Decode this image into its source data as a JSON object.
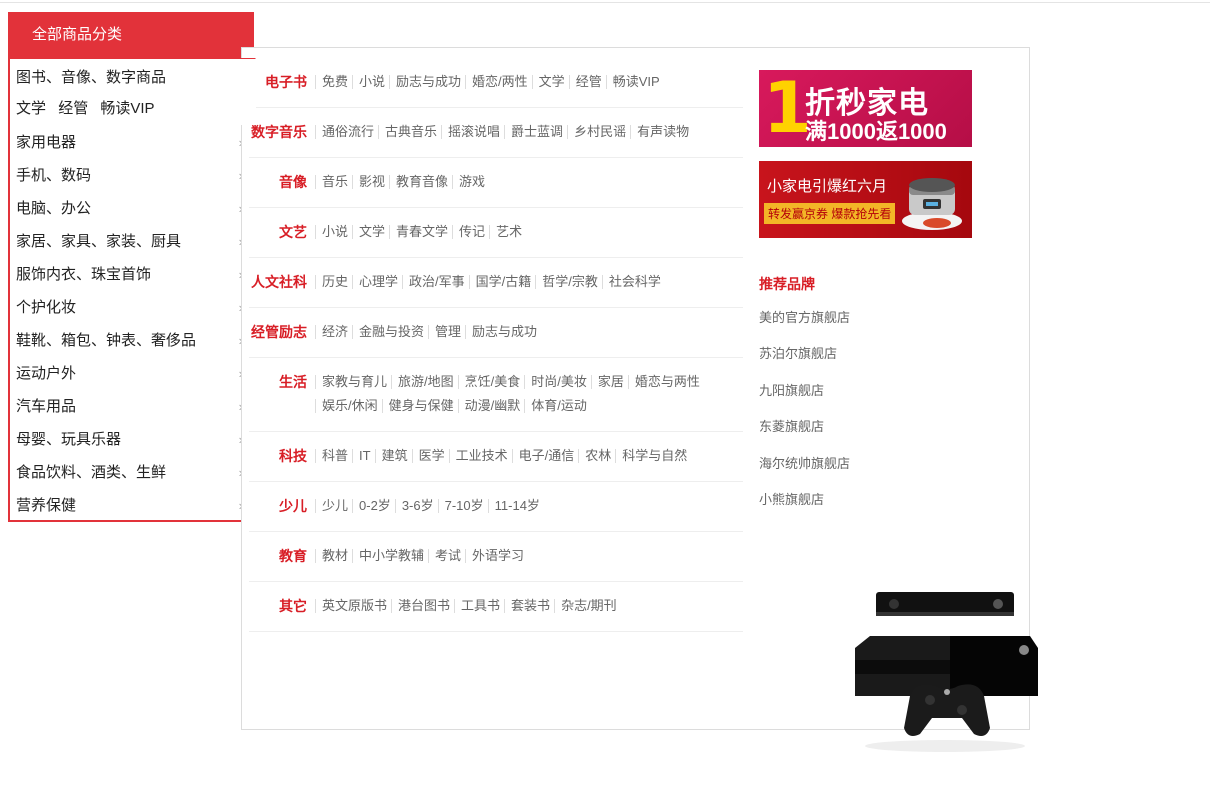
{
  "category_header": "全部商品分类",
  "active_category": {
    "line1": "图书、音像、数字商品",
    "line2": [
      "文学",
      "经管",
      "畅读VIP"
    ]
  },
  "categories": [
    {
      "label": "家用电器"
    },
    {
      "label": "手机、数码"
    },
    {
      "label": "电脑、办公"
    },
    {
      "label": "家居、家具、家装、厨具"
    },
    {
      "label": "服饰内衣、珠宝首饰"
    },
    {
      "label": "个护化妆"
    },
    {
      "label": "鞋靴、箱包、钟表、奢侈品"
    },
    {
      "label": "运动户外"
    },
    {
      "label": "汽车用品"
    },
    {
      "label": "母婴、玩具乐器"
    },
    {
      "label": "食品饮料、酒类、生鲜"
    },
    {
      "label": "营养保健"
    }
  ],
  "arrow_glyph": "›",
  "subcategories": [
    {
      "title": "电子书",
      "links": [
        "免费",
        "小说",
        "励志与成功",
        "婚恋/两性",
        "文学",
        "经管",
        "畅读VIP"
      ]
    },
    {
      "title": "数字音乐",
      "links": [
        "通俗流行",
        "古典音乐",
        "摇滚说唱",
        "爵士蓝调",
        "乡村民谣",
        "有声读物"
      ]
    },
    {
      "title": "音像",
      "links": [
        "音乐",
        "影视",
        "教育音像",
        "游戏"
      ]
    },
    {
      "title": "文艺",
      "links": [
        "小说",
        "文学",
        "青春文学",
        "传记",
        "艺术"
      ]
    },
    {
      "title": "人文社科",
      "links": [
        "历史",
        "心理学",
        "政治/军事",
        "国学/古籍",
        "哲学/宗教",
        "社会科学"
      ]
    },
    {
      "title": "经管励志",
      "links": [
        "经济",
        "金融与投资",
        "管理",
        "励志与成功"
      ]
    },
    {
      "title": "生活",
      "links": [
        "家教与育儿",
        "旅游/地图",
        "烹饪/美食",
        "时尚/美妆",
        "家居",
        "婚恋与两性",
        "娱乐/休闲",
        "健身与保健",
        "动漫/幽默",
        "体育/运动"
      ]
    },
    {
      "title": "科技",
      "links": [
        "科普",
        "IT",
        "建筑",
        "医学",
        "工业技术",
        "电子/通信",
        "农林",
        "科学与自然"
      ]
    },
    {
      "title": "少儿",
      "links": [
        "少儿",
        "0-2岁",
        "3-6岁",
        "7-10岁",
        "11-14岁"
      ]
    },
    {
      "title": "教育",
      "links": [
        "教材",
        "中小学教辅",
        "考试",
        "外语学习"
      ]
    },
    {
      "title": "其它",
      "links": [
        "英文原版书",
        "港台图书",
        "工具书",
        "套装书",
        "杂志/期刊"
      ]
    }
  ],
  "banner1": {
    "num": "1",
    "line1": "折秒家电",
    "line2": "满1000返1000"
  },
  "banner2": {
    "line1": "小家电引爆红六月",
    "line2": "转发赢京券 爆款抢先看"
  },
  "brands_title": "推荐品牌",
  "brands": [
    "美的官方旗舰店",
    "苏泊尔旗舰店",
    "九阳旗舰店",
    "东菱旗舰店",
    "海尔统帅旗舰店",
    "小熊旗舰店"
  ],
  "colors": {
    "accent": "#e2323a",
    "title_red": "#d81e26"
  }
}
